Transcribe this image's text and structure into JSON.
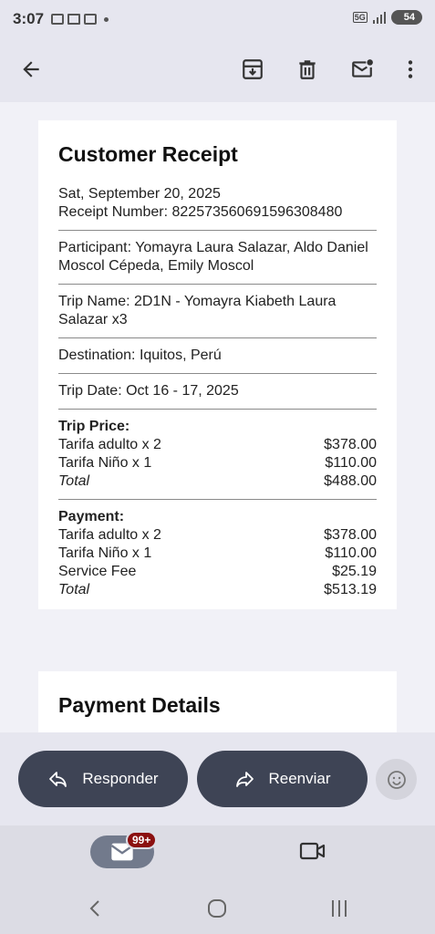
{
  "status_bar": {
    "time": "3:07",
    "network": "5G",
    "battery": "54"
  },
  "app_bar": {
    "icons": [
      "back-arrow-icon",
      "archive-icon",
      "delete-icon",
      "mark-unread-icon",
      "more-vert-icon"
    ]
  },
  "receipt": {
    "title": "Customer Receipt",
    "date": "Sat, September 20, 2025",
    "receipt_number": "Receipt Number: 822573560691596308480",
    "participant": "Participant: Yomayra Laura Salazar, Aldo Daniel Moscol Cépeda, Emily Moscol",
    "trip_name": "Trip Name: 2D1N - Yomayra Kiabeth Laura Salazar x3",
    "destination": "Destination: Iquitos, Perú",
    "trip_date": "Trip Date: Oct 16 - 17, 2025",
    "trip_price": {
      "heading": "Trip Price:",
      "items": [
        {
          "label": "Tarifa adulto x 2",
          "amount": "$378.00"
        },
        {
          "label": "Tarifa Niño x 1",
          "amount": "$110.00"
        }
      ],
      "total_label": "Total",
      "total_amount": "$488.00"
    },
    "payment": {
      "heading": "Payment:",
      "items": [
        {
          "label": "Tarifa adulto x 2",
          "amount": "$378.00"
        },
        {
          "label": "Tarifa Niño x 1",
          "amount": "$110.00"
        },
        {
          "label": "Service Fee",
          "amount": "$25.19"
        }
      ],
      "total_label": "Total",
      "total_amount": "$513.19"
    }
  },
  "payment_details": {
    "title": "Payment Details"
  },
  "actions": {
    "reply_label": "Responder",
    "forward_label": "Reenviar"
  },
  "bottom_nav": {
    "mail_badge": "99+"
  },
  "colors": {
    "pill_bg": "#3e4455",
    "badge_bg": "#8b1010",
    "bar_bg": "#e6e6ef"
  }
}
